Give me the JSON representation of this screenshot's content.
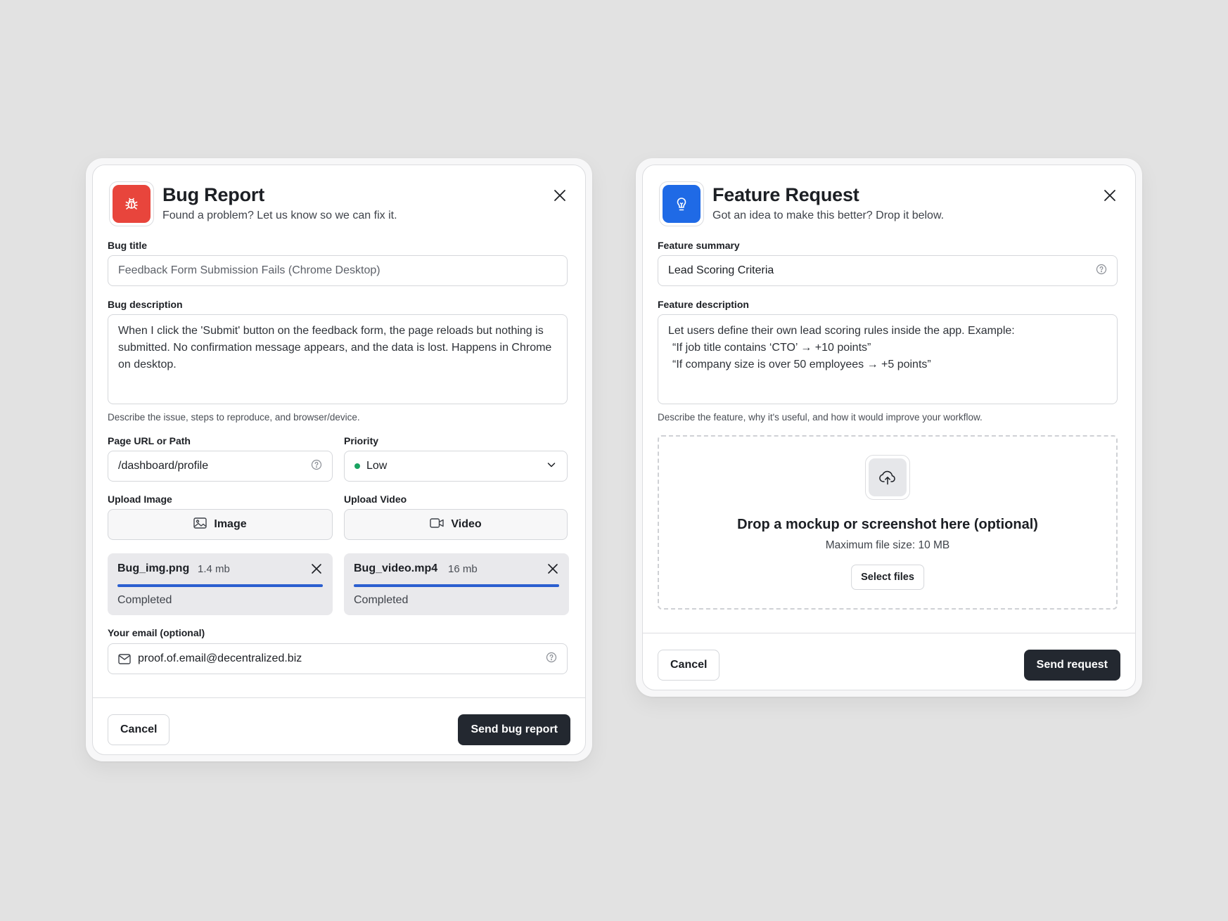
{
  "bug_report": {
    "title": "Bug Report",
    "subtitle": "Found a problem? Let us know so we can fix it.",
    "icon": "bug-icon",
    "accent": "#e8453c",
    "bug_title_label": "Bug title",
    "bug_title_placeholder": "Feedback Form Submission Fails (Chrome Desktop)",
    "bug_description_label": "Bug description",
    "bug_description_value": "When I click the 'Submit' button on the feedback form, the page reloads but nothing is submitted. No confirmation message appears, and the data is lost. Happens in Chrome on desktop.",
    "bug_description_hint": "Describe the issue, steps to reproduce, and browser/device.",
    "page_url_label": "Page URL or Path",
    "page_url_value": "/dashboard/profile",
    "priority_label": "Priority",
    "priority_value": "Low",
    "priority_dot_color": "#1aa361",
    "upload_image_label": "Upload Image",
    "upload_image_button": "Image",
    "upload_video_label": "Upload Video",
    "upload_video_button": "Video",
    "files": [
      {
        "name": "Bug_img.png",
        "size": "1.4 mb",
        "status": "Completed",
        "progress": 1.0
      },
      {
        "name": "Bug_video.mp4",
        "size": "16 mb",
        "status": "Completed",
        "progress": 1.0
      }
    ],
    "email_label": "Your email (optional)",
    "email_value": "proof.of.email@decentralized.biz",
    "cancel_label": "Cancel",
    "submit_label": "Send bug report"
  },
  "feature_request": {
    "title": "Feature Request",
    "subtitle": "Got an idea to make this better? Drop it below.",
    "icon": "lightbulb-icon",
    "accent": "#1f6ae6",
    "summary_label": "Feature summary",
    "summary_value": "Lead Scoring Criteria",
    "description_label": "Feature description",
    "description_lines": [
      "Let users define their own lead scoring rules inside the app. Example:",
      "“If job title contains ‘CTO’ → +10 points”",
      "“If company size is over 50 employees → +5 points”"
    ],
    "description_hint": "Describe the feature, why it's useful, and how it would improve your workflow.",
    "dropzone_title": "Drop a mockup or screenshot here (optional)",
    "dropzone_subtitle": "Maximum file size: 10 MB",
    "select_files_label": "Select files",
    "cancel_label": "Cancel",
    "submit_label": "Send request"
  }
}
